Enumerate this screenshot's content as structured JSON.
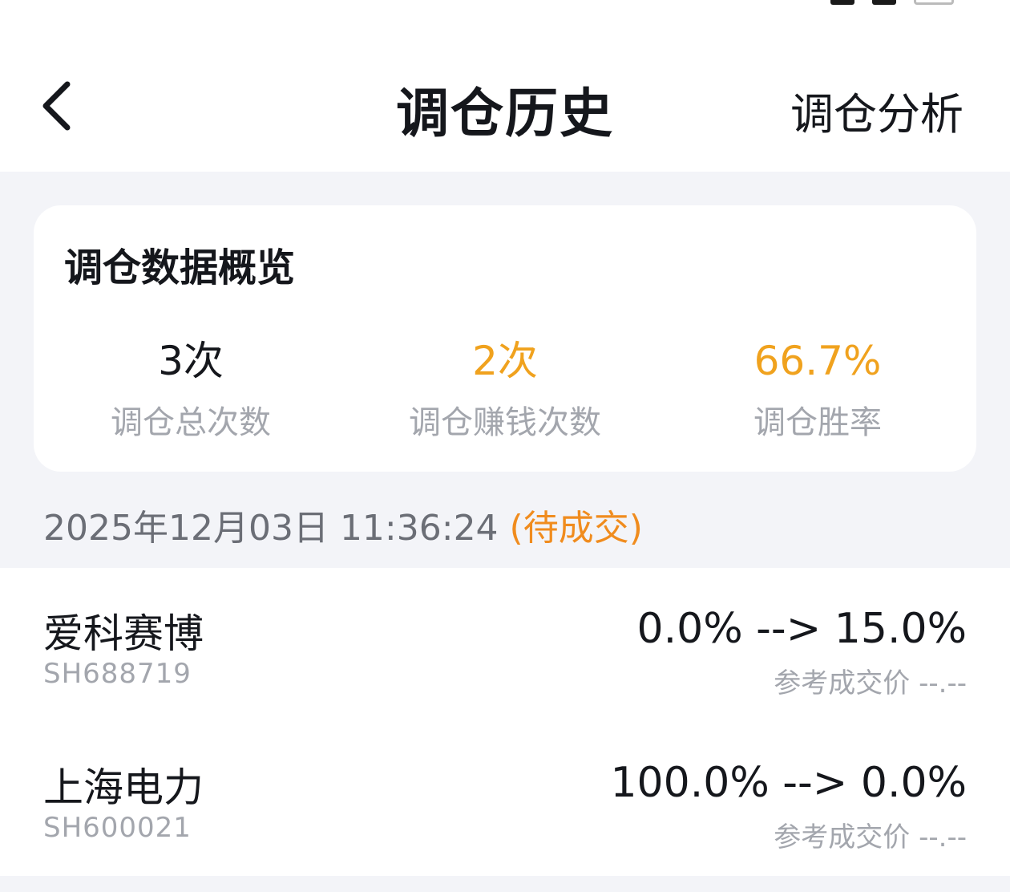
{
  "header": {
    "title": "调仓历史",
    "right_action": "调仓分析"
  },
  "overview": {
    "title": "调仓数据概览",
    "stats": [
      {
        "value": "3次",
        "label": "调仓总次数",
        "color": "#15171c"
      },
      {
        "value": "2次",
        "label": "调仓赚钱次数",
        "color": "#f0a21e"
      },
      {
        "value": "66.7%",
        "label": "调仓胜率",
        "color": "#f0a21e"
      }
    ]
  },
  "record": {
    "datetime": "2025年12月03日  11:36:24 ",
    "status": "(待成交)",
    "items": [
      {
        "name": "爱科赛博",
        "code": "SH688719",
        "change": "0.0% --> 15.0%",
        "ref_label": "参考成交价",
        "ref_price": "--.--"
      },
      {
        "name": "上海电力",
        "code": "SH600021",
        "change": "100.0% --> 0.0%",
        "ref_label": "参考成交价",
        "ref_price": "--.--"
      }
    ]
  },
  "icons": {
    "back": "chevron-left-icon"
  }
}
